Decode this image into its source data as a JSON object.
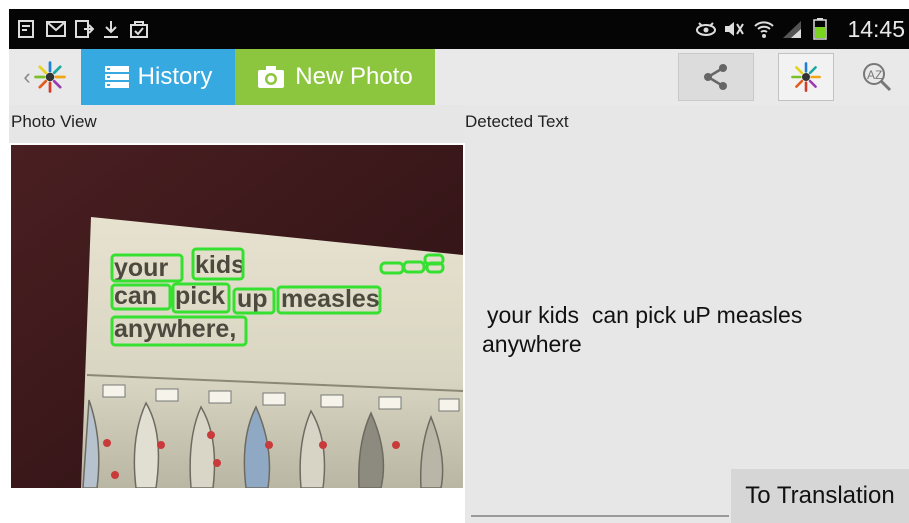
{
  "status_bar": {
    "time": "14:45",
    "left_icons": [
      "notification-icon",
      "mail-icon",
      "screen-icon",
      "download-icon",
      "bag-icon"
    ],
    "right_icons": [
      "eye-icon",
      "mute-icon",
      "wifi-icon",
      "signal-icon",
      "battery-icon"
    ]
  },
  "action_bar": {
    "tabs": [
      {
        "label": "History",
        "icon": "list-icon",
        "color": "#37a9e1"
      },
      {
        "label": "New Photo",
        "icon": "camera-icon",
        "color": "#8cc63f"
      }
    ],
    "actions": [
      "share-icon",
      "app-logo-icon",
      "az-search-icon"
    ]
  },
  "photo_view": {
    "label": "Photo View"
  },
  "detected": {
    "label": "Detected Text",
    "line1": "your kids  can pick uP measles",
    "line2": "anywhere"
  },
  "to_translation_label": "To Translation",
  "colors": {
    "history_tab": "#37a9e1",
    "new_photo_tab": "#8cc63f",
    "detection_box": "#35e030"
  }
}
